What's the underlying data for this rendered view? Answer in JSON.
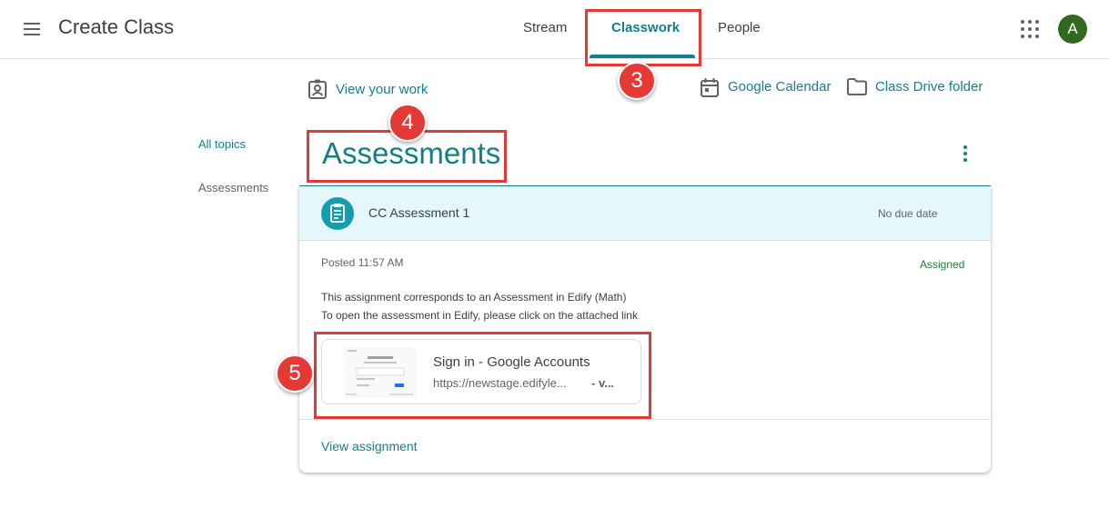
{
  "header": {
    "app_title": "Create Class",
    "tabs": [
      {
        "label": "Stream"
      },
      {
        "label": "Classwork"
      },
      {
        "label": "People"
      }
    ],
    "avatar_letter": "A"
  },
  "actions": {
    "view_work": "View your work",
    "calendar": "Google Calendar",
    "drive": "Class Drive folder"
  },
  "sidebar": {
    "items": [
      {
        "label": "All topics"
      },
      {
        "label": "Assessments"
      }
    ]
  },
  "topic": {
    "title": "Assessments"
  },
  "assignment": {
    "title": "CC Assessment 1",
    "due": "No due date",
    "posted": "Posted 11:57 AM",
    "status": "Assigned",
    "description_line1": "This assignment corresponds to an Assessment in Edify (Math)",
    "description_line2": "To open the assessment in Edify, please click on the attached link",
    "attachment": {
      "title": "Sign in - Google Accounts",
      "url": "https://newstage.edifyle...",
      "suffix": "- v..."
    },
    "view_link": "View assignment"
  },
  "callouts": {
    "classwork_step": "3",
    "topic_step": "4",
    "attachment_step": "5"
  },
  "colors": {
    "accent": "#137f8a",
    "callout": "#e53935",
    "assignment_icon": "#129eaf",
    "card_header": "#e4f7fb",
    "avatar": "#33691e",
    "status": "#188038"
  }
}
